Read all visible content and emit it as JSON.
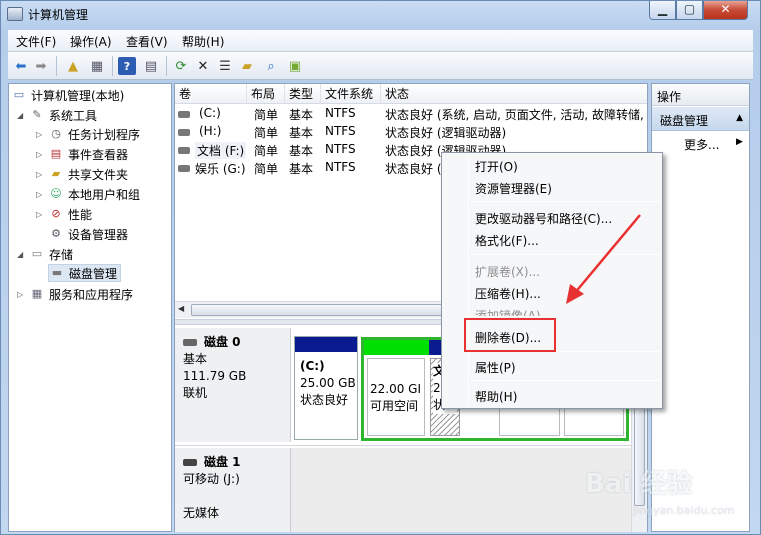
{
  "window": {
    "title": "计算机管理",
    "min": "▁",
    "max": "▢",
    "close": "✕"
  },
  "menubar": [
    "文件(F)",
    "操作(A)",
    "查看(V)",
    "帮助(H)"
  ],
  "toolbar_icons": [
    "back-icon",
    "forward-icon",
    "up-folder-icon",
    "show-hide-tree-icon",
    "help-icon",
    "show-hide-action-icon",
    "refresh-icon",
    "delete-icon",
    "properties-icon",
    "open-folder-icon",
    "search-icon",
    "export-icon"
  ],
  "tree": {
    "root": "计算机管理(本地)",
    "system_tools": "系统工具",
    "task_scheduler": "任务计划程序",
    "event_viewer": "事件查看器",
    "shared_folders": "共享文件夹",
    "local_users": "本地用户和组",
    "performance": "性能",
    "device_manager": "设备管理器",
    "storage": "存储",
    "disk_management": "磁盘管理",
    "services": "服务和应用程序"
  },
  "volume_list": {
    "headers": [
      "卷",
      "布局",
      "类型",
      "文件系统",
      "状态"
    ],
    "rows": [
      {
        "vol": "(C:)",
        "layout": "简单",
        "type": "基本",
        "fs": "NTFS",
        "status": "状态良好 (系统, 启动, 页面文件, 活动, 故障转储, 主"
      },
      {
        "vol": "(H:)",
        "layout": "简单",
        "type": "基本",
        "fs": "NTFS",
        "status": "状态良好 (逻辑驱动器)"
      },
      {
        "vol": "文档 (F:)",
        "layout": "简单",
        "type": "基本",
        "fs": "NTFS",
        "status": "状态良好 (逻辑驱动器)"
      },
      {
        "vol": "娱乐 (G:)",
        "layout": "简单",
        "type": "基本",
        "fs": "NTFS",
        "status": "状态良好 (逻辑驱动器)"
      }
    ]
  },
  "disks": {
    "disk0": {
      "name": "磁盘 0",
      "type": "基本",
      "size": "111.79 GB",
      "state": "联机"
    },
    "disk1": {
      "name": "磁盘 1",
      "type": "可移动 (J:)",
      "state": "无媒体"
    },
    "partitions": [
      {
        "label": "(C:)",
        "size": "25.00 GB",
        "status": "状态良好"
      },
      {
        "label": "",
        "size": "22.00 GI",
        "status": "可用空间"
      },
      {
        "label": "文",
        "size": "2",
        "status": "状"
      }
    ]
  },
  "actions": {
    "header": "操作",
    "section": "磁盘管理",
    "more": "更多...",
    "section_arrow": "▲",
    "more_arrow": "▶"
  },
  "context_menu": {
    "open": "打开(O)",
    "explorer": "资源管理器(E)",
    "change_letter": "更改驱动器号和路径(C)...",
    "format": "格式化(F)...",
    "extend": "扩展卷(X)...",
    "shrink": "压缩卷(H)...",
    "mirror": "添加镜像(A)...",
    "delete": "删除卷(D)...",
    "properties": "属性(P)",
    "help": "帮助(H)"
  },
  "watermark": {
    "brand": "Bai 经验",
    "url": "jingyan.baidu.com"
  },
  "colors": {
    "primary_partition": "#0a1a8f",
    "extended_partition": "#2fb52f",
    "highlight": "#e83232"
  }
}
